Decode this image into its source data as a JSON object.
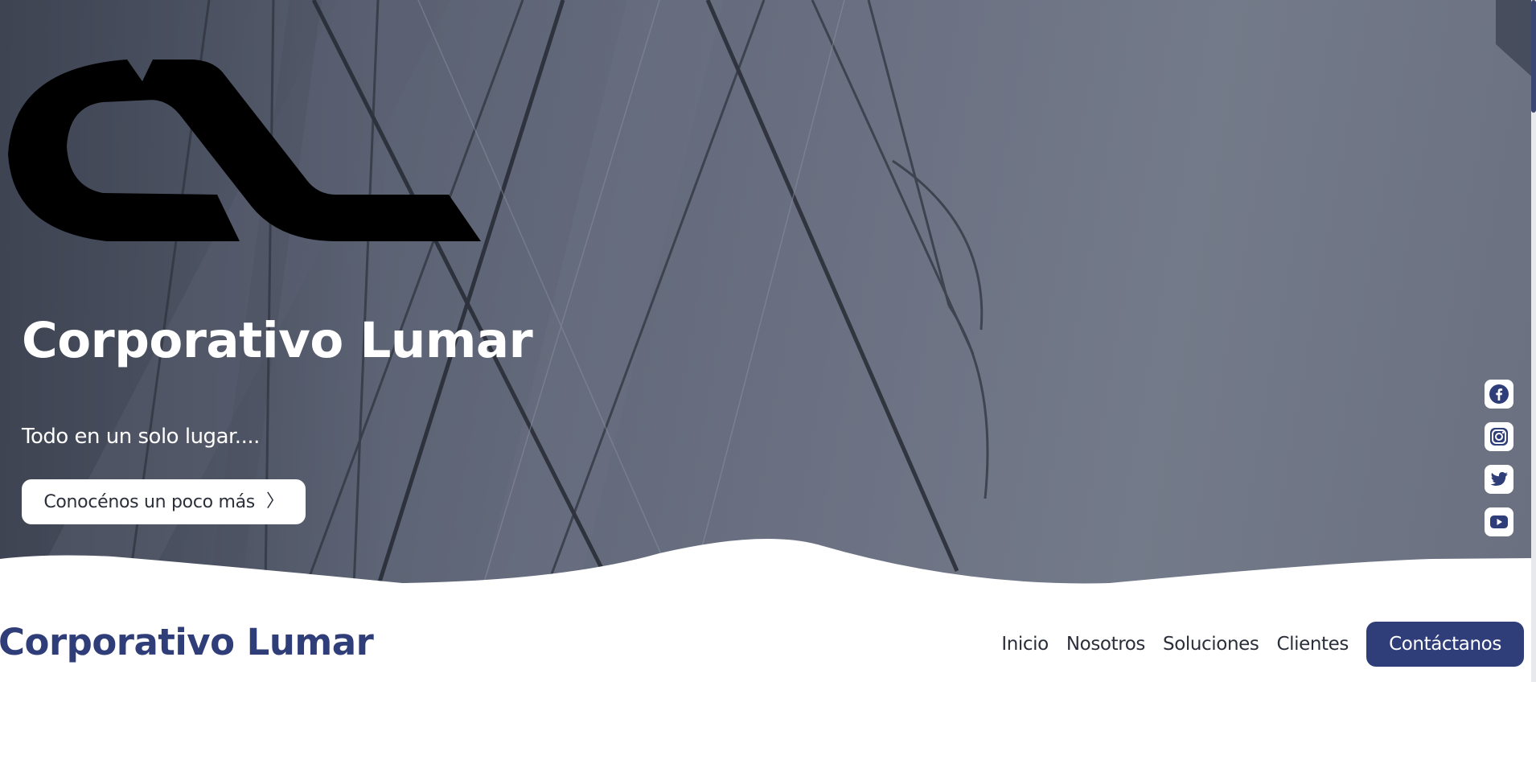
{
  "hero": {
    "title": "Corporativo Lumar",
    "subtitle": "Todo en un solo lugar....",
    "cta_label": "Conocénos un poco más",
    "cta_icon": "chevron-right-icon",
    "logo": "lumar-logo-mark"
  },
  "social": {
    "items": [
      {
        "name": "facebook",
        "icon": "facebook-icon"
      },
      {
        "name": "instagram",
        "icon": "instagram-icon"
      },
      {
        "name": "twitter",
        "icon": "twitter-icon"
      },
      {
        "name": "youtube",
        "icon": "youtube-icon"
      }
    ]
  },
  "nav": {
    "brand": "Corporativo Lumar",
    "links": [
      "Inicio",
      "Nosotros",
      "Soluciones",
      "Clientes"
    ],
    "contact_label": "Contáctanos"
  },
  "colors": {
    "brand_blue": "#2f3d78",
    "hero_overlay": "#6b7182",
    "text_dark": "#2b2f3a",
    "white": "#ffffff"
  }
}
